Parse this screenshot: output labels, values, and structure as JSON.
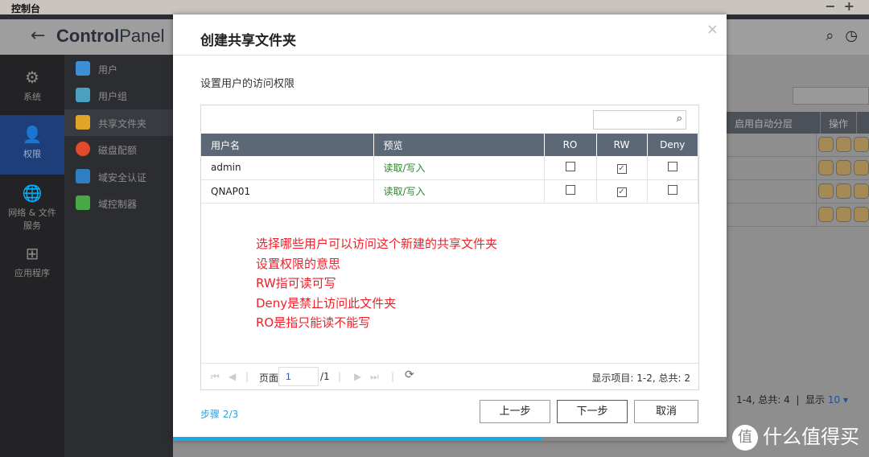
{
  "window": {
    "title": "控制台",
    "minimize": "−",
    "maximize": "+"
  },
  "header": {
    "back": "←",
    "logo_bold": "Control",
    "logo_light": "Panel"
  },
  "leftnav": [
    {
      "label": "系统",
      "icon": "gear-icon"
    },
    {
      "label": "权限",
      "icon": "user-icon",
      "active": true
    },
    {
      "label": "网络 & 文件服务",
      "icon": "globe-icon"
    },
    {
      "label": "应用程序",
      "icon": "apps-icon"
    }
  ],
  "subnav": [
    {
      "label": "用户",
      "color": "#3d8fd8"
    },
    {
      "label": "用户组",
      "color": "#4aa0c0"
    },
    {
      "label": "共享文件夹",
      "color": "#e2a528",
      "active": true
    },
    {
      "label": "磁盘配额",
      "color": "#e24a2a"
    },
    {
      "label": "域安全认证",
      "color": "#2f7ec4"
    },
    {
      "label": "域控制器",
      "color": "#48a848"
    }
  ],
  "background": {
    "columns": [
      "启用自动分层",
      "操作"
    ],
    "rows": 4,
    "footer": {
      "range": "1-4, 总共: 4",
      "show_label": "显示",
      "show_value": "10"
    }
  },
  "modal": {
    "title": "创建共享文件夹",
    "close": "×",
    "subtitle": "设置用户的访问权限",
    "search_placeholder": "",
    "columns": [
      "用户名",
      "预览",
      "RO",
      "RW",
      "Deny"
    ],
    "rows": [
      {
        "user": "admin",
        "preview": "读取/写入",
        "ro": false,
        "rw": true,
        "deny": false
      },
      {
        "user": "QNAP01",
        "preview": "读取/写入",
        "ro": false,
        "rw": true,
        "deny": false
      }
    ],
    "annotation": [
      "选择哪些用户可以访问这个新建的共享文件夹",
      "设置权限的意思",
      "RW指可读可写",
      "Deny是禁止访问此文件夹",
      "RO是指只能读不能写"
    ],
    "pager": {
      "page_label": "页面",
      "page": "1",
      "total": "/1",
      "summary": "显示项目:  1-2, 总共:  2"
    },
    "step": "步骤 2/3",
    "buttons": {
      "prev": "上一步",
      "next": "下一步",
      "cancel": "取消"
    },
    "progress": 0.667
  },
  "watermark": {
    "glyph": "值",
    "text": "什么值得买"
  }
}
